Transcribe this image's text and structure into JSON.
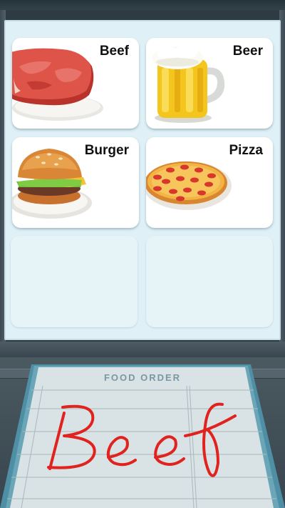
{
  "menu": {
    "items": [
      {
        "label": "Beef",
        "icon": "beef-steak-icon"
      },
      {
        "label": "Beer",
        "icon": "beer-mug-icon"
      },
      {
        "label": "Burger",
        "icon": "burger-icon"
      },
      {
        "label": "Pizza",
        "icon": "pizza-icon"
      }
    ],
    "empty_slots": 2
  },
  "order_pad": {
    "title": "FOOD ORDER",
    "handwritten_order": "Beef",
    "ink_color": "#e0231f"
  },
  "colors": {
    "screen": "#dff0f7",
    "card": "#ffffff",
    "empty_card": "#e6f4f7",
    "pad": "#d8e1e3",
    "pad_frame": "#4f8fa5"
  }
}
